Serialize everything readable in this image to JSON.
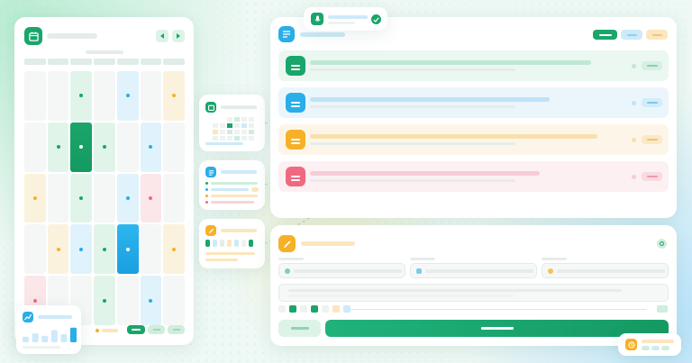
{
  "icons": {
    "calendar": "calendar-icon",
    "list": "list-icon",
    "edit": "pencil-icon",
    "chart": "chart-icon",
    "mic": "microphone-icon",
    "check": "check-icon",
    "clock": "clock-icon"
  },
  "colors": {
    "green": "#1aa56b",
    "blue": "#29aee9",
    "orange": "#f6b128",
    "red": "#ef6a80",
    "background": "#eef8f4"
  },
  "mini_chart": {
    "bar_levels": [
      0.35,
      0.55,
      0.4,
      0.75,
      0.5,
      0.9
    ]
  },
  "tasks": {
    "rows": [
      {
        "color": "green",
        "title_fill": 0.82,
        "sub_fill": 0.6
      },
      {
        "color": "blue",
        "title_fill": 0.7,
        "sub_fill": 0.6
      },
      {
        "color": "orange",
        "title_fill": 0.84,
        "sub_fill": 0.6
      },
      {
        "color": "red",
        "title_fill": 0.67,
        "sub_fill": 0.6
      }
    ]
  }
}
